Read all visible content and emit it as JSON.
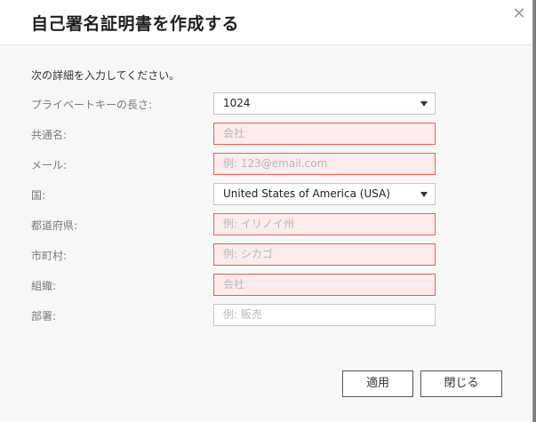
{
  "dialog": {
    "title": "自己署名証明書を作成する",
    "close_glyph": "✕",
    "instruction": "次の詳細を入力してください。"
  },
  "form": {
    "private_key_length": {
      "label": "プライベートキーの長さ:",
      "value": "1024"
    },
    "common_name": {
      "label": "共通名:",
      "placeholder": "会社"
    },
    "email": {
      "label": "メール:",
      "placeholder": "例: 123@email.com"
    },
    "country": {
      "label": "国:",
      "value": "United States of America (USA)"
    },
    "state": {
      "label": "都道府県:",
      "placeholder": "例: イリノイ州"
    },
    "city": {
      "label": "市町村:",
      "placeholder": "例: シカゴ"
    },
    "organization": {
      "label": "組織:",
      "placeholder": "会社"
    },
    "department": {
      "label": "部署:",
      "placeholder": "例: 販売"
    }
  },
  "buttons": {
    "apply": "適用",
    "close": "閉じる"
  },
  "colors": {
    "invalid_bg": "#fdeceb",
    "invalid_border": "#e0625a"
  }
}
